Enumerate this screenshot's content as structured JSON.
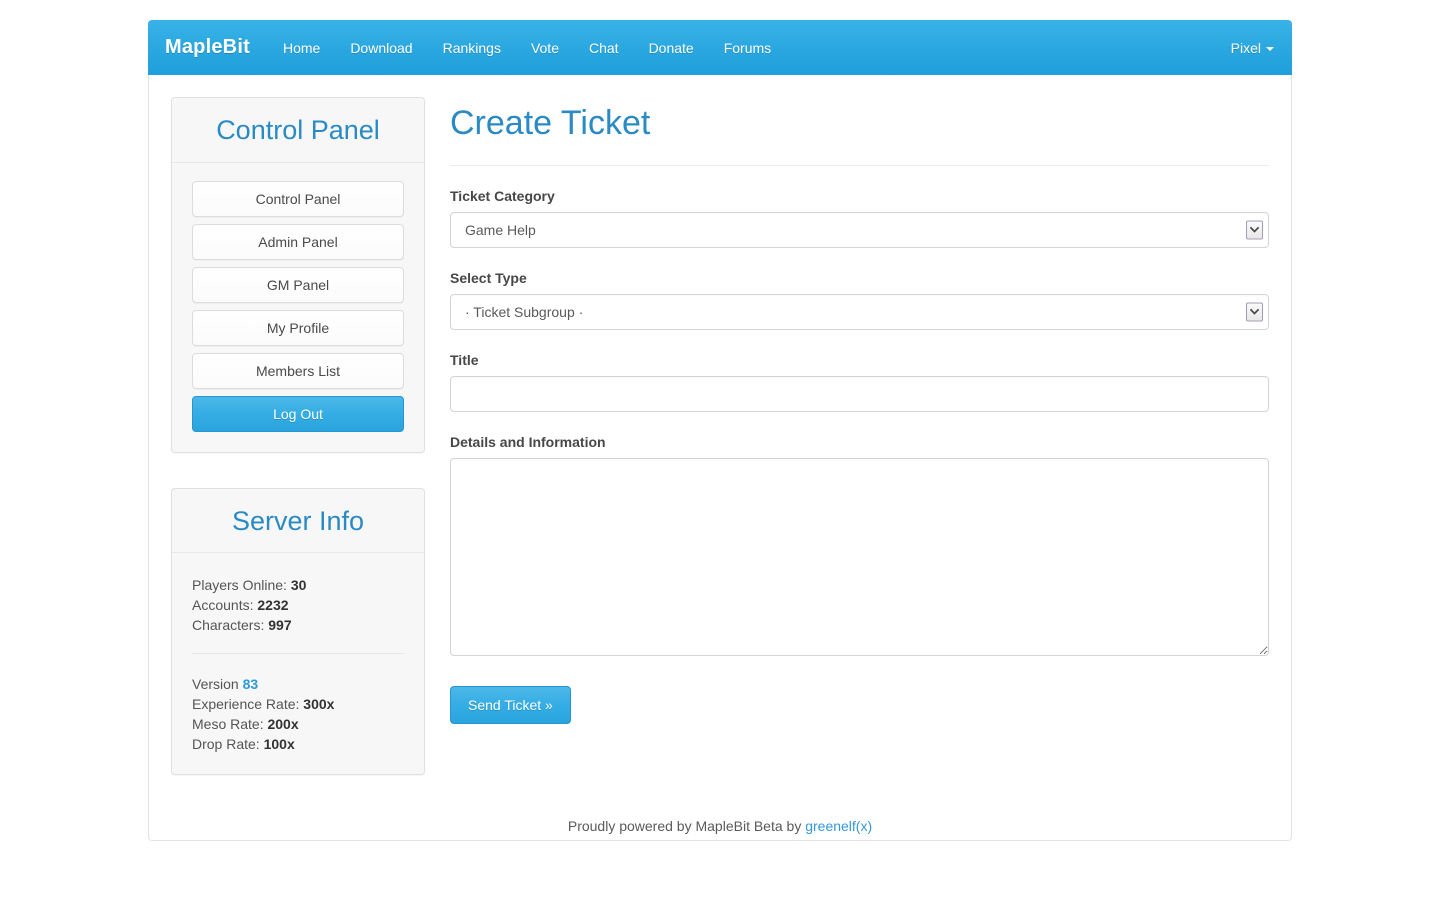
{
  "navbar": {
    "brand": "MapleBit",
    "links": [
      {
        "label": "Home"
      },
      {
        "label": "Download"
      },
      {
        "label": "Rankings"
      },
      {
        "label": "Vote"
      },
      {
        "label": "Chat"
      },
      {
        "label": "Donate"
      },
      {
        "label": "Forums"
      }
    ],
    "user": "Pixel",
    "user_caret_icon": "caret-down-icon",
    "accent_color": "#29aae3"
  },
  "sidebar": {
    "control_panel": {
      "title": "Control Panel",
      "buttons": [
        {
          "label": "Control Panel",
          "style": "white"
        },
        {
          "label": "Admin Panel",
          "style": "white"
        },
        {
          "label": "GM Panel",
          "style": "white"
        },
        {
          "label": "My Profile",
          "style": "white"
        },
        {
          "label": "Members List",
          "style": "white"
        },
        {
          "label": "Log Out",
          "style": "blue"
        }
      ]
    },
    "server_info": {
      "title": "Server Info",
      "stats": [
        {
          "label": "Players Online:",
          "value": "30"
        },
        {
          "label": "Accounts:",
          "value": "2232"
        },
        {
          "label": "Characters:",
          "value": "997"
        }
      ],
      "version_label": "Version",
      "version_value": "83",
      "rates": [
        {
          "label": "Experience Rate:",
          "value": "300x"
        },
        {
          "label": "Meso Rate:",
          "value": "200x"
        },
        {
          "label": "Drop Rate:",
          "value": "100x"
        }
      ]
    }
  },
  "main": {
    "page_title": "Create Ticket",
    "fields": {
      "category_label": "Ticket Category",
      "category_value": "Game Help",
      "type_label": "Select Type",
      "type_value": "· Ticket Subgroup ·",
      "title_label": "Title",
      "title_value": "",
      "title_placeholder": "",
      "details_label": "Details and Information",
      "details_value": "",
      "details_placeholder": ""
    },
    "submit_label": "Send Ticket »"
  },
  "footer": {
    "text": "Proudly powered by MapleBit Beta by ",
    "link": "greenelf(x)"
  }
}
